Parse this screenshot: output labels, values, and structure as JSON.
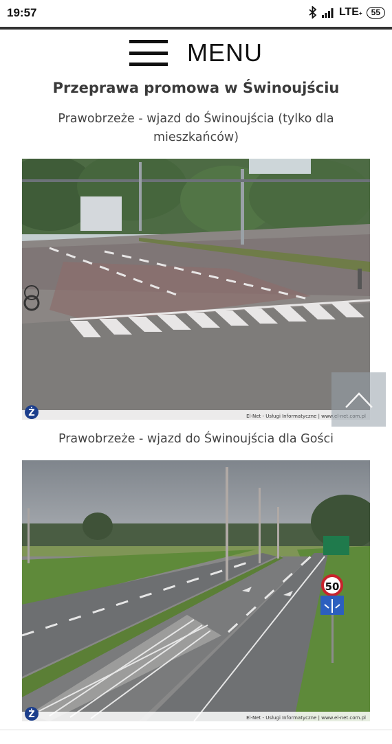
{
  "status": {
    "time": "19:57",
    "network": "LTE",
    "network_sub": "+",
    "battery": "55"
  },
  "menu": {
    "label": "MENU"
  },
  "page": {
    "title": "Przeprawa promowa w Świnoujściu"
  },
  "cameras": [
    {
      "caption": "Prawobrzeże - wjazd do Świnoujścia (tylko dla mieszkańców)",
      "footer": "El-Net - Usługi Informatyczne | www.el-net.com.pl",
      "logo": "Ż"
    },
    {
      "caption": "Prawobrzeże - wjazd do Świnoujścia dla Gości",
      "footer": "El-Net - Usługi Informatyczne | www.el-net.com.pl",
      "logo": "Ż",
      "speed_limit": "50"
    }
  ],
  "icons": {
    "bluetooth": "bluetooth-icon",
    "signal": "signal-icon",
    "battery": "battery-icon",
    "menu": "hamburger-icon",
    "scroll_top": "chevron-up-icon"
  }
}
